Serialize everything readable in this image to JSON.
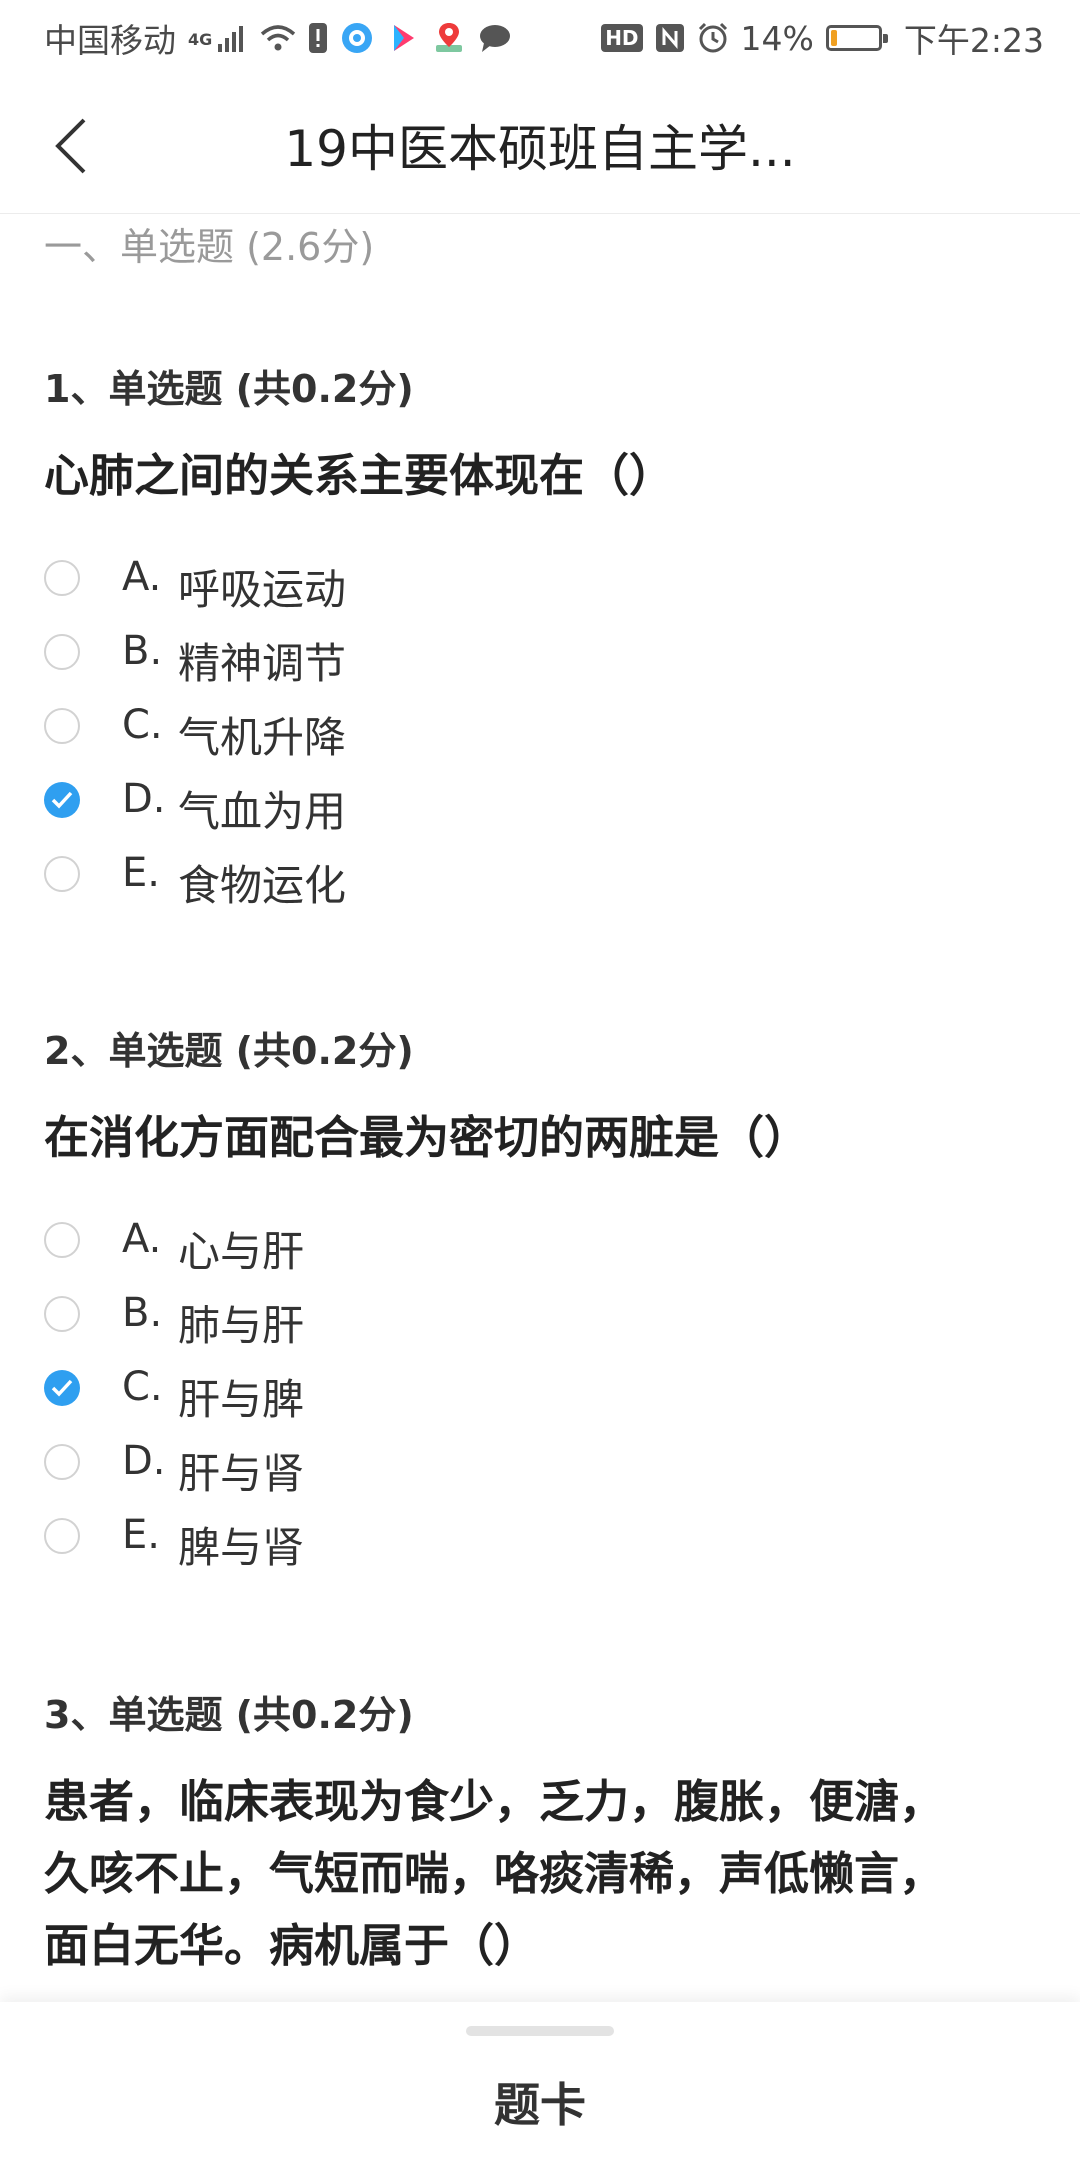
{
  "status_bar": {
    "carrier": "中国移动",
    "network": "4G",
    "hd": "HD",
    "battery": "14%",
    "battery_level": 0.14,
    "time": "下午2:23"
  },
  "header": {
    "title": "19中医本硕班自主学..."
  },
  "section": {
    "title": "一、单选题  (2.6分)"
  },
  "questions": [
    {
      "label": "1、单选题  (共0.2分)",
      "text": "心肺之间的关系主要体现在（）",
      "options": [
        {
          "letter": "A.",
          "text": "呼吸运动",
          "checked": false
        },
        {
          "letter": "B.",
          "text": "精神调节",
          "checked": false
        },
        {
          "letter": "C.",
          "text": "气机升降",
          "checked": false
        },
        {
          "letter": "D.",
          "text": "气血为用",
          "checked": true
        },
        {
          "letter": "E.",
          "text": "食物运化",
          "checked": false
        }
      ]
    },
    {
      "label": "2、单选题  (共0.2分)",
      "text": "在消化方面配合最为密切的两脏是（）",
      "options": [
        {
          "letter": "A.",
          "text": "心与肝",
          "checked": false
        },
        {
          "letter": "B.",
          "text": "肺与肝",
          "checked": false
        },
        {
          "letter": "C.",
          "text": "肝与脾",
          "checked": true
        },
        {
          "letter": "D.",
          "text": "肝与肾",
          "checked": false
        },
        {
          "letter": "E.",
          "text": "脾与肾",
          "checked": false
        }
      ]
    },
    {
      "label": "3、单选题  (共0.2分)",
      "text_lines": [
        "患者，临床表现为食少，乏力，腹胀，便溏，",
        "久咳不止，气短而喘，咯痰清稀，声低懒言，",
        "面白无华。病机属于（）"
      ]
    }
  ],
  "bottom_bar": {
    "answer_card_label": "题卡"
  },
  "colors": {
    "accent": "#2f9ff0",
    "section_title": "#9a9a9a"
  }
}
